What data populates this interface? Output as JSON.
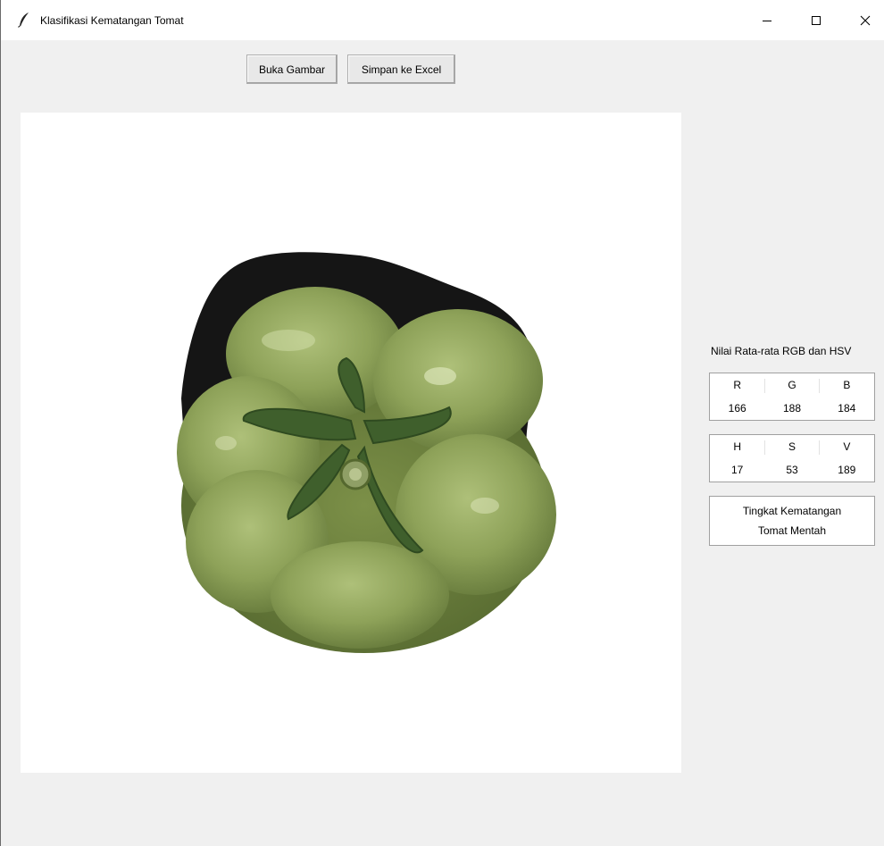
{
  "window": {
    "title": "Klasifikasi Kematangan Tomat",
    "icon": "feather-icon",
    "controls": [
      "minimize-icon",
      "maximize-icon",
      "close-icon"
    ]
  },
  "toolbar": {
    "open_label": "Buka Gambar",
    "save_label": "Simpan ke Excel"
  },
  "preview": {
    "subject": "green-tomato-photo"
  },
  "panel": {
    "title": "Nilai Rata-rata RGB dan HSV",
    "rgb": {
      "headers": [
        "R",
        "G",
        "B"
      ],
      "values": [
        "166",
        "188",
        "184"
      ]
    },
    "hsv": {
      "headers": [
        "H",
        "S",
        "V"
      ],
      "values": [
        "17",
        "53",
        "189"
      ]
    },
    "result": {
      "label": "Tingkat Kematangan",
      "value": "Tomat Mentah"
    }
  },
  "colors": {
    "window_bg": "#f0f0f0",
    "tomato_green": "#8fa65a",
    "stem_green": "#3f5f2c",
    "shadow": "#141414"
  }
}
